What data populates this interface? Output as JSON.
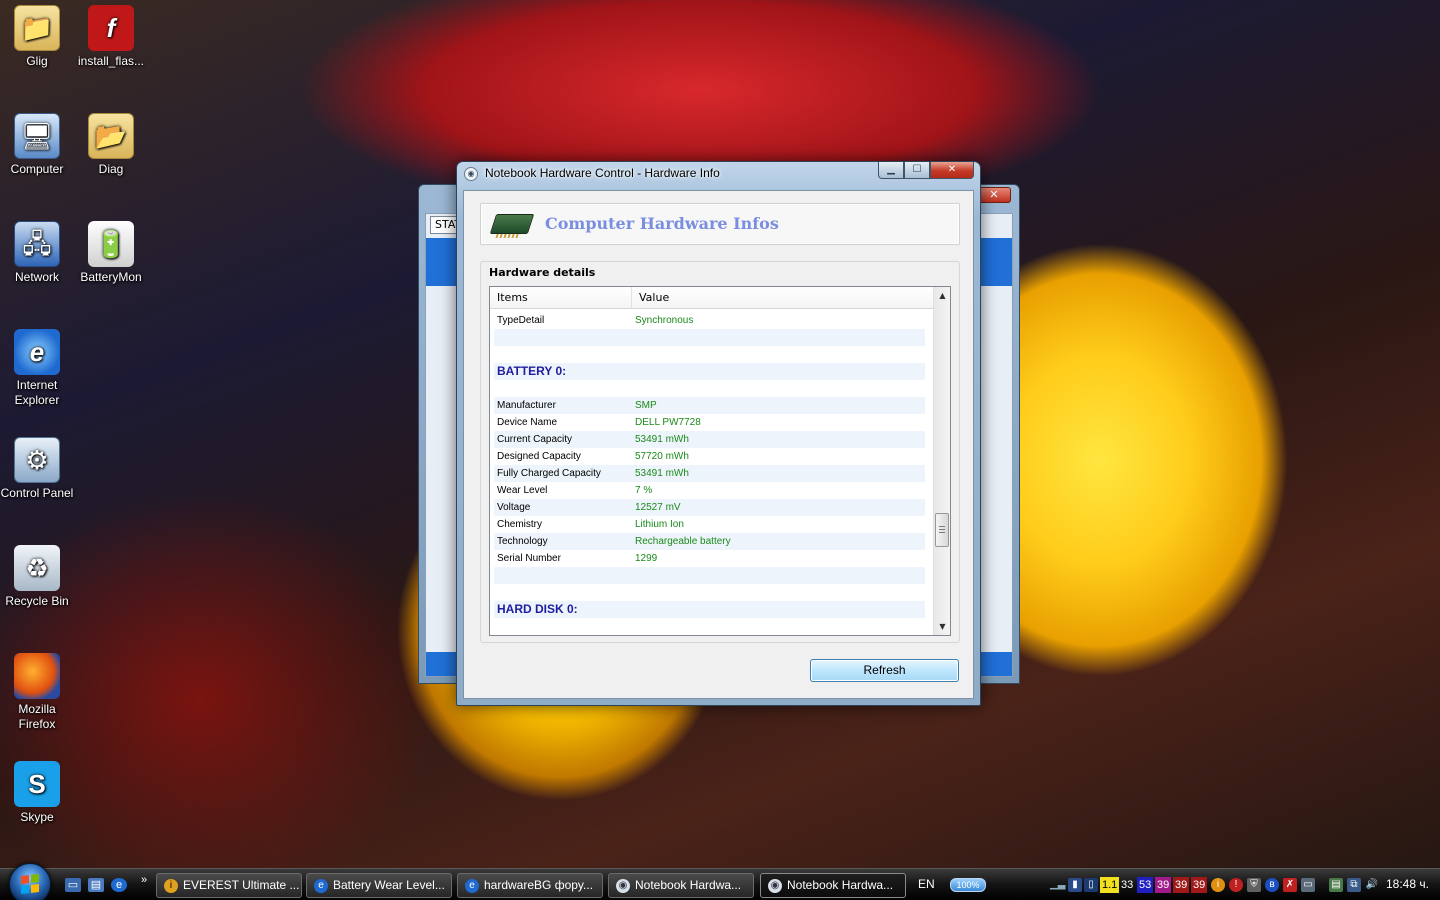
{
  "desktop": {
    "icons": [
      {
        "label": "Glig"
      },
      {
        "label": "install_flas..."
      },
      {
        "label": "Computer"
      },
      {
        "label": "Diag"
      },
      {
        "label": "Network"
      },
      {
        "label": "BatteryMon"
      },
      {
        "label": "Internet Explorer"
      },
      {
        "label": "Control Panel"
      },
      {
        "label": "Recycle Bin"
      },
      {
        "label": "Mozilla Firefox"
      },
      {
        "label": "Skype"
      }
    ]
  },
  "background_window": {
    "tab_label": "STAT"
  },
  "dialog": {
    "title": "Notebook Hardware Control - Hardware Info",
    "header_title": "Computer Hardware Infos",
    "group_label": "Hardware details",
    "columns": {
      "items": "Items",
      "value": "Value"
    },
    "rows": [
      {
        "item": "TypeDetail",
        "value": "Synchronous"
      },
      {
        "item": "",
        "value": ""
      },
      {
        "item": "",
        "value": ""
      },
      {
        "item": "BATTERY 0:",
        "value": ""
      },
      {
        "item": "",
        "value": ""
      },
      {
        "item": "Manufacturer",
        "value": "SMP"
      },
      {
        "item": "Device Name",
        "value": "DELL PW7728"
      },
      {
        "item": "Current Capacity",
        "value": "53491 mWh"
      },
      {
        "item": "Designed Capacity",
        "value": "57720 mWh"
      },
      {
        "item": "Fully Charged Capacity",
        "value": "53491 mWh"
      },
      {
        "item": "Wear Level",
        "value": "7 %"
      },
      {
        "item": "Voltage",
        "value": "12527 mV"
      },
      {
        "item": "Chemistry",
        "value": "Lithium Ion"
      },
      {
        "item": "Technology",
        "value": "Rechargeable battery"
      },
      {
        "item": "Serial Number",
        "value": "1299"
      },
      {
        "item": "",
        "value": ""
      },
      {
        "item": "",
        "value": ""
      },
      {
        "item": "HARD DISK 0:",
        "value": ""
      }
    ],
    "refresh_label": "Refresh"
  },
  "taskbar": {
    "buttons": [
      {
        "label": "EVEREST Ultimate ...",
        "icon": "everest-icon"
      },
      {
        "label": "Battery Wear Level...",
        "icon": "ie-icon"
      },
      {
        "label": "hardwareBG форy...",
        "icon": "ie-icon"
      },
      {
        "label": "Notebook Hardwa...",
        "icon": "nhc-icon"
      },
      {
        "label": "Notebook Hardwa...",
        "icon": "nhc-icon"
      }
    ],
    "tray": {
      "language": "EN",
      "battery_percent": "100%",
      "numbers": [
        "1.1",
        "33",
        "53",
        "39",
        "39",
        "39"
      ],
      "clock": "18:48 ч."
    }
  }
}
